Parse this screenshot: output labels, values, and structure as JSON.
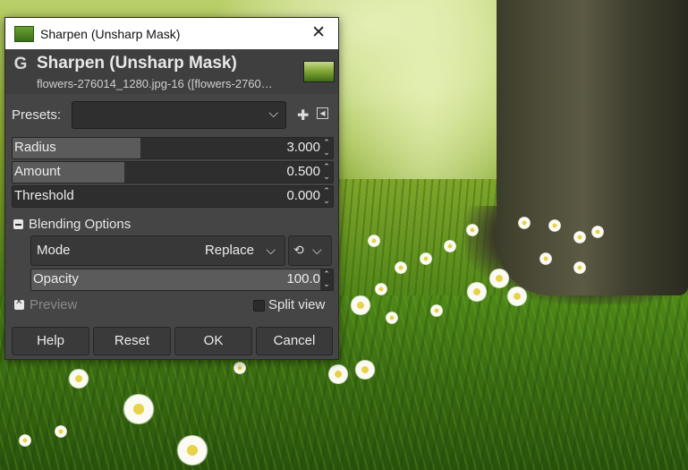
{
  "window": {
    "title": "Sharpen (Unsharp Mask)",
    "close_glyph": "✕"
  },
  "header": {
    "title": "Sharpen (Unsharp Mask)",
    "subtitle": "flowers-276014_1280.jpg-16 ([flowers-2760…",
    "logo_glyph": "G"
  },
  "presets": {
    "label": "Presets:",
    "value": "",
    "add_glyph": "✚",
    "menu_glyph": "◂"
  },
  "params": {
    "radius": {
      "label": "Radius",
      "value": "3.000",
      "fill_fraction": 0.4
    },
    "amount": {
      "label": "Amount",
      "value": "0.500",
      "fill_fraction": 0.35
    },
    "threshold": {
      "label": "Threshold",
      "value": "0.000",
      "fill_fraction": 0.0
    }
  },
  "blending": {
    "header": "Blending Options",
    "expanded": true,
    "mode_label": "Mode",
    "mode_value": "Replace",
    "opacity_label": "Opacity",
    "opacity_value": "100.0",
    "opacity_fraction": 1.0
  },
  "preview": {
    "label": "Preview",
    "checked": true
  },
  "split_view": {
    "label": "Split view",
    "checked": false
  },
  "buttons": {
    "help": "Help",
    "reset": "Reset",
    "ok": "OK",
    "cancel": "Cancel"
  },
  "icons": {
    "dropdown": "chevron-down-icon",
    "spinner": "spin-arrows-icon",
    "composite": "composite-mode-icon"
  },
  "colors": {
    "dialog_bg": "#454545",
    "header_bg": "#3f3f3f",
    "field_bg": "#2e2e2e",
    "slider_fill": "#5b5b5b",
    "text": "#e6e6e6",
    "disabled_text": "#8a8a8a"
  }
}
